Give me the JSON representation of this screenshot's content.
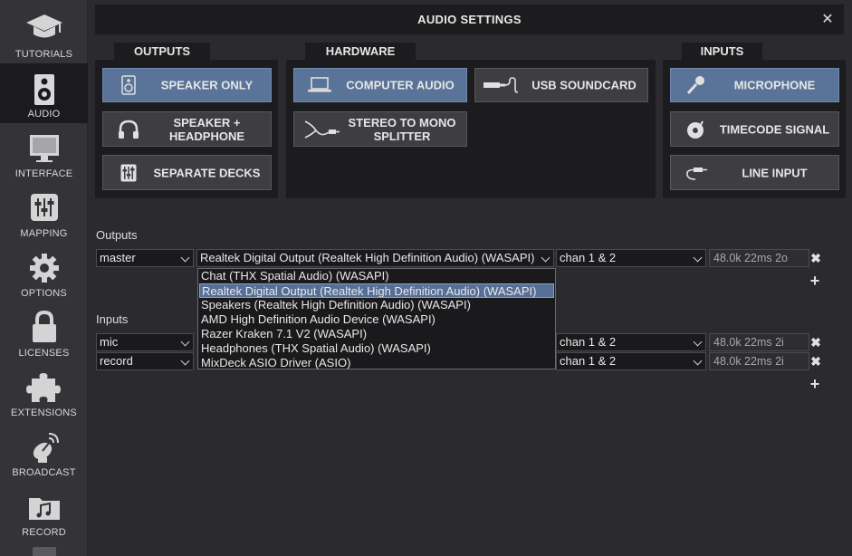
{
  "window": {
    "title": "AUDIO SETTINGS",
    "close_glyph": "✕"
  },
  "sidebar": {
    "items": [
      {
        "label": "TUTORIALS",
        "icon": "graduation-cap-icon"
      },
      {
        "label": "AUDIO",
        "icon": "speaker-icon",
        "active": true
      },
      {
        "label": "INTERFACE",
        "icon": "monitor-icon"
      },
      {
        "label": "MAPPING",
        "icon": "sliders-icon"
      },
      {
        "label": "OPTIONS",
        "icon": "gear-icon"
      },
      {
        "label": "LICENSES",
        "icon": "lock-icon"
      },
      {
        "label": "EXTENSIONS",
        "icon": "puzzle-icon"
      },
      {
        "label": "BROADCAST",
        "icon": "satellite-dish-icon"
      },
      {
        "label": "RECORD",
        "icon": "music-folder-icon"
      }
    ]
  },
  "outputs_panel": {
    "tab": "OUTPUTS",
    "buttons": [
      {
        "label": "SPEAKER ONLY",
        "icon": "speaker-icon",
        "selected": true
      },
      {
        "label": "SPEAKER + HEADPHONE",
        "icon": "headphone-icon",
        "selected": false
      },
      {
        "label": "SEPARATE DECKS",
        "icon": "mixer-icon",
        "selected": false
      }
    ]
  },
  "hardware_panel": {
    "tab": "HARDWARE",
    "buttons": [
      {
        "label": "COMPUTER AUDIO",
        "icon": "laptop-icon",
        "selected": true
      },
      {
        "label": "USB SOUNDCARD",
        "icon": "usb-cable-icon",
        "selected": false
      },
      {
        "label": "STEREO TO MONO SPLITTER",
        "icon": "splitter-cable-icon",
        "selected": false
      }
    ]
  },
  "inputs_panel": {
    "tab": "INPUTS",
    "buttons": [
      {
        "label": "MICROPHONE",
        "icon": "microphone-icon",
        "selected": true
      },
      {
        "label": "TIMECODE SIGNAL",
        "icon": "turntable-icon",
        "selected": false
      },
      {
        "label": "LINE INPUT",
        "icon": "rca-cable-icon",
        "selected": false
      }
    ]
  },
  "outputs_section": {
    "label": "Outputs",
    "rows": [
      {
        "role": "master",
        "device": "Realtek Digital Output (Realtek High Definition Audio) (WASAPI)",
        "channels": "chan 1 & 2",
        "info": "48.0k 22ms 2o"
      }
    ],
    "remove_glyph": "✖",
    "add_glyph": "+"
  },
  "inputs_section": {
    "label": "Inputs",
    "rows": [
      {
        "role": "mic",
        "channels": "chan 1 & 2",
        "info": "48.0k 22ms 2i"
      },
      {
        "role": "record",
        "channels": "chan 1 & 2",
        "info": "48.0k 22ms 2i"
      }
    ],
    "remove_glyph": "✖",
    "add_glyph": "+"
  },
  "device_dropdown": {
    "options": [
      "Chat (THX Spatial Audio) (WASAPI)",
      "Realtek Digital Output (Realtek High Definition Audio) (WASAPI)",
      "Speakers (Realtek High Definition Audio) (WASAPI)",
      "AMD High Definition Audio Device (WASAPI)",
      "Razer Kraken 7.1 V2 (WASAPI)",
      "Headphones (THX Spatial Audio) (WASAPI)",
      "MixDeck ASIO Driver (ASIO)"
    ],
    "highlighted": 1
  },
  "colors": {
    "accent_selected": "#5a7499",
    "panel_bg": "#1c1c1e",
    "window_bg": "#2b2b2f"
  }
}
